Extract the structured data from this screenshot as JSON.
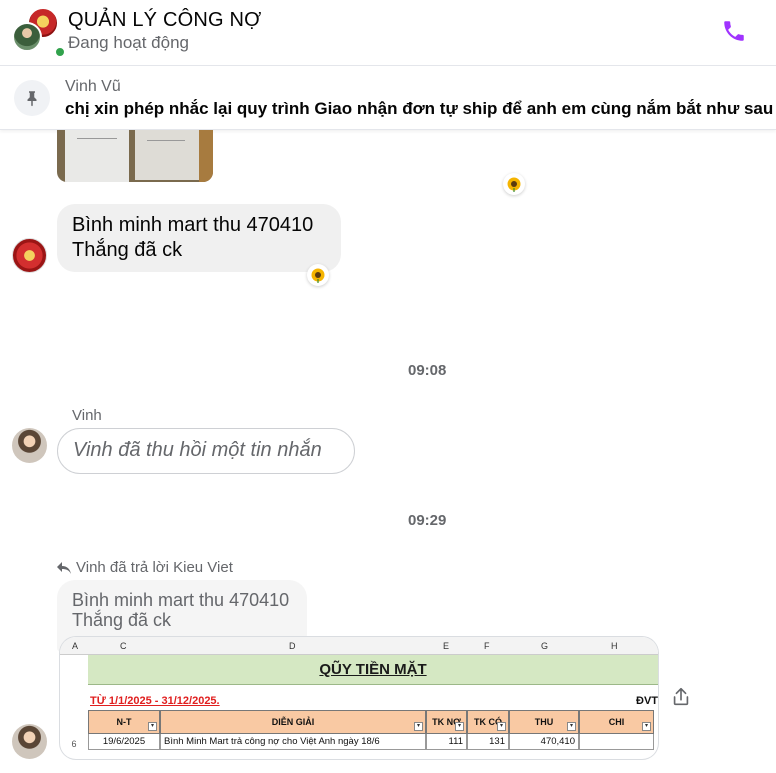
{
  "header": {
    "title": "QUẢN LÝ CÔNG NỢ",
    "status": "Đang hoạt động",
    "accent_color": "#a033ff",
    "icons": [
      "group-avatar",
      "phone-icon"
    ]
  },
  "pinned": {
    "sender": "Vinh Vũ",
    "text": "chị xin phép nhắc lại quy trình Giao nhận đơn tự ship để anh em cùng nắm bắt như sau"
  },
  "messages": {
    "mart_message": {
      "line1": "Bình minh mart thu 470410",
      "line2": "Thắng đã ck"
    },
    "time1": "09:08",
    "vinh_sender": "Vinh",
    "recalled_text": "Vinh đã thu hồi một tin nhắn",
    "time2": "09:29",
    "reply_label": "Vinh đã trả lời Kieu Viet",
    "quoted": {
      "line1": "Bình minh mart thu 470410",
      "line2": "Thắng đã ck"
    }
  },
  "reactions": [
    "sunflower",
    "sunflower"
  ],
  "spreadsheet": {
    "col_letters": [
      "A",
      "C",
      "D",
      "E",
      "F",
      "G",
      "H"
    ],
    "banner_title": "QŨY TIỀN MẶT",
    "date_range": "TỪ 1/1/2025 - 31/12/2025.",
    "unit_label": "ĐVT",
    "row_number": "6",
    "headers": [
      "N-T",
      "DIỄN GIẢI",
      "TK NỢ",
      "TK CÓ",
      "THU",
      "CHI"
    ],
    "row": {
      "date": "19/6/2025",
      "desc": "Bình Minh Mart trả công nợ cho Việt Anh ngày 18/6",
      "tk_no": "111",
      "tk_co": "131",
      "thu": "470,410",
      "chi": ""
    }
  }
}
